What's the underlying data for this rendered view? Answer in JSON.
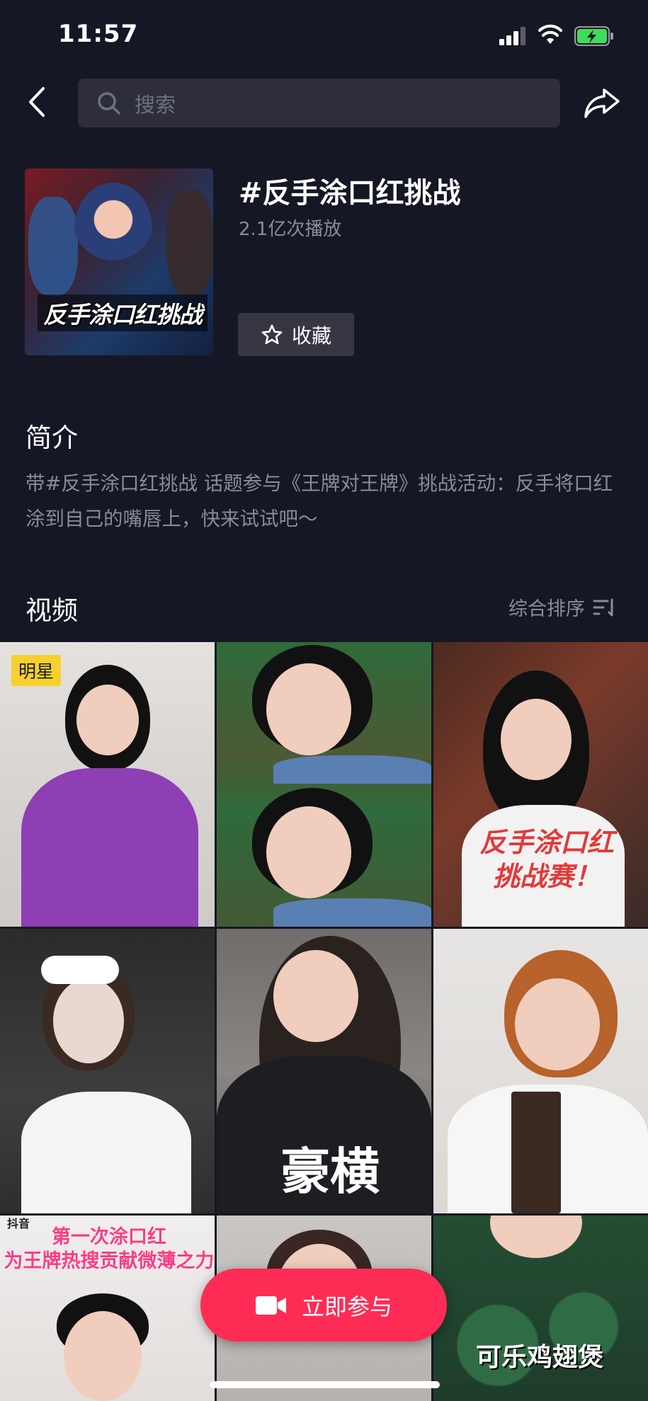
{
  "status_bar": {
    "time": "11:57"
  },
  "nav": {
    "back_icon": "chevron-left-icon",
    "search_placeholder": "搜索",
    "search_icon": "search-icon",
    "share_icon": "share-icon"
  },
  "topic": {
    "cover_caption": "反手涂口红挑战",
    "title": "#反手涂口红挑战",
    "play_count": "2.1亿次播放",
    "collect_label": "收藏",
    "collect_icon": "star-outline-icon"
  },
  "intro": {
    "title": "简介",
    "text": "带#反手涂口红挑战 话题参与《王牌对王牌》挑战活动：反手将口红涂到自己的嘴唇上，快来试试吧～"
  },
  "videos": {
    "title": "视频",
    "sort_label": "综合排序",
    "sort_icon": "sort-icon",
    "items": [
      {
        "badge": "明星",
        "overlay": ""
      },
      {
        "badge": "",
        "overlay": ""
      },
      {
        "badge": "",
        "overlay": "反手涂口红\n挑战赛！"
      },
      {
        "badge": "",
        "overlay": ""
      },
      {
        "badge": "",
        "overlay": "豪横"
      },
      {
        "badge": "",
        "overlay": ""
      },
      {
        "badge": "",
        "overlay": "第一次涂口红\n为王牌热搜贡献微薄之力",
        "watermark": "抖音"
      },
      {
        "badge": "",
        "overlay": ""
      },
      {
        "badge": "",
        "overlay": "可乐鸡翅煲"
      }
    ]
  },
  "join_button": {
    "label": "立即参与",
    "icon": "video-camera-icon"
  },
  "colors": {
    "background": "#161724",
    "accent": "#fe2c55",
    "badge": "#f7d02c"
  }
}
